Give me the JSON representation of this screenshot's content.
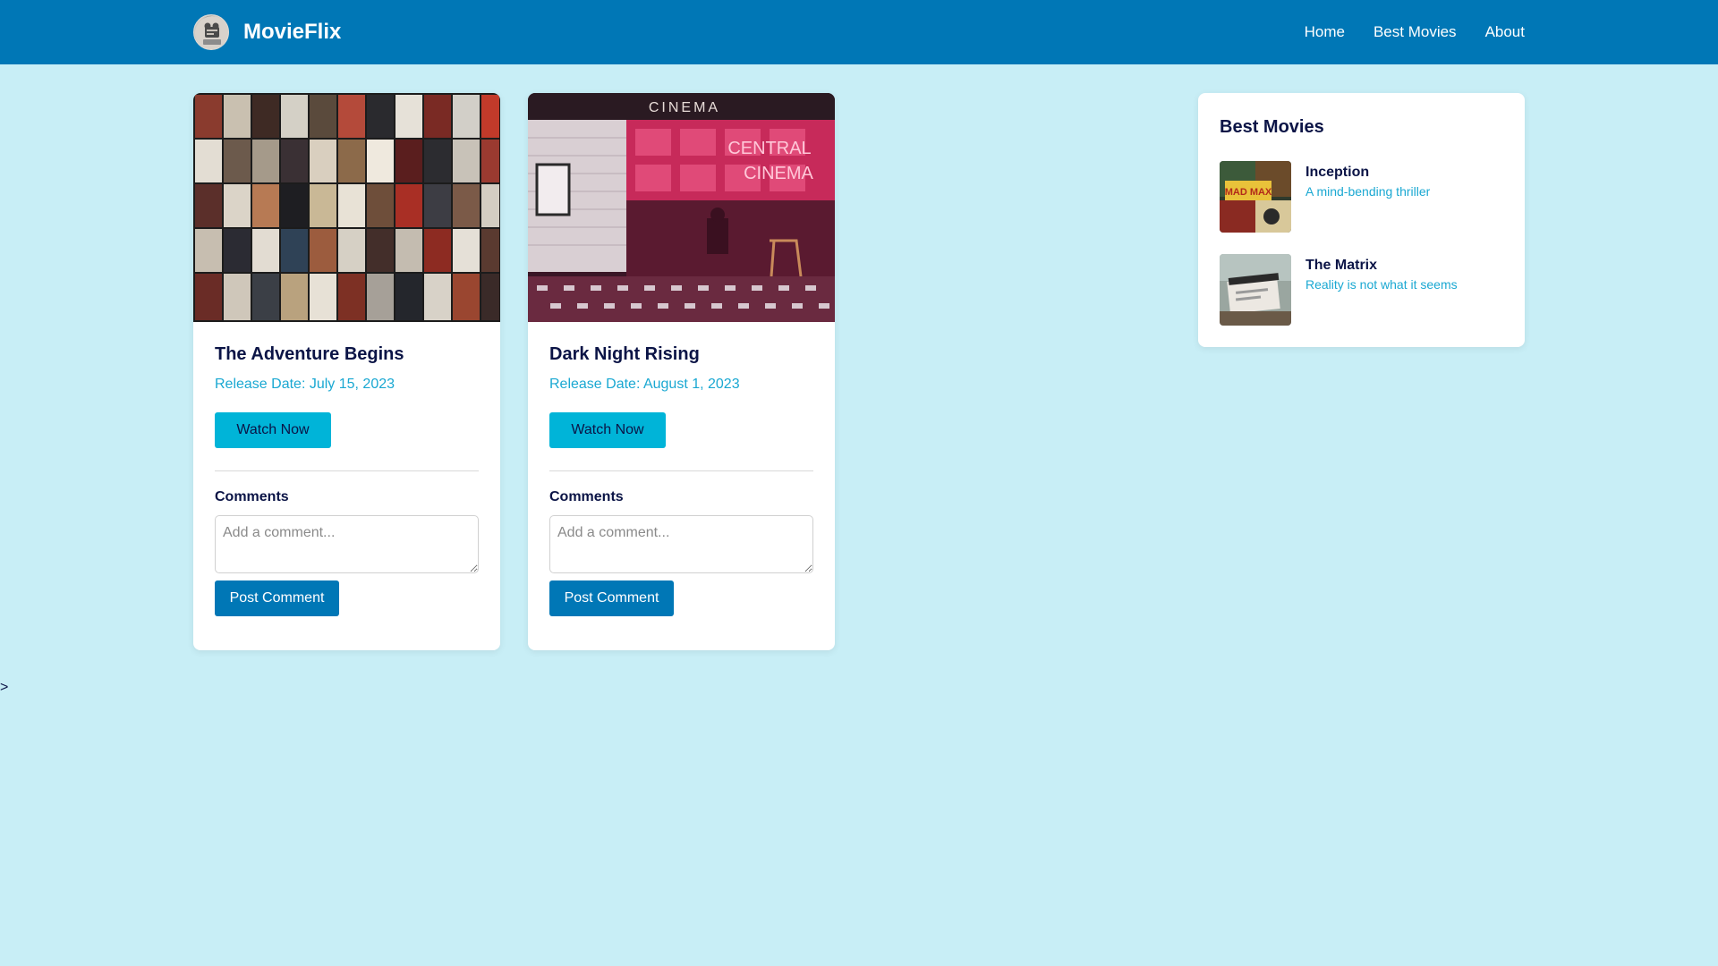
{
  "header": {
    "brand": "MovieFlix",
    "nav": [
      "Home",
      "Best Movies",
      "About"
    ]
  },
  "movies": [
    {
      "title": "The Adventure Begins",
      "release": "Release Date: July 15, 2023",
      "watch_label": "Watch Now",
      "comments_label": "Comments",
      "comment_placeholder": "Add a comment...",
      "post_label": "Post Comment"
    },
    {
      "title": "Dark Night Rising",
      "release": "Release Date: August 1, 2023",
      "watch_label": "Watch Now",
      "comments_label": "Comments",
      "comment_placeholder": "Add a comment...",
      "post_label": "Post Comment"
    }
  ],
  "sidebar": {
    "title": "Best Movies",
    "items": [
      {
        "title": "Inception",
        "description": "A mind-bending thriller"
      },
      {
        "title": "The Matrix",
        "description": "Reality is not what it seems"
      }
    ]
  },
  "stray_text": ">",
  "colors": {
    "header": "#0077b6",
    "page_background": "#c8eef6",
    "accent_button": "#00b4d8",
    "primary_button": "#0077b6",
    "link_text": "#1aa8d2",
    "heading_text": "#0b1446"
  }
}
